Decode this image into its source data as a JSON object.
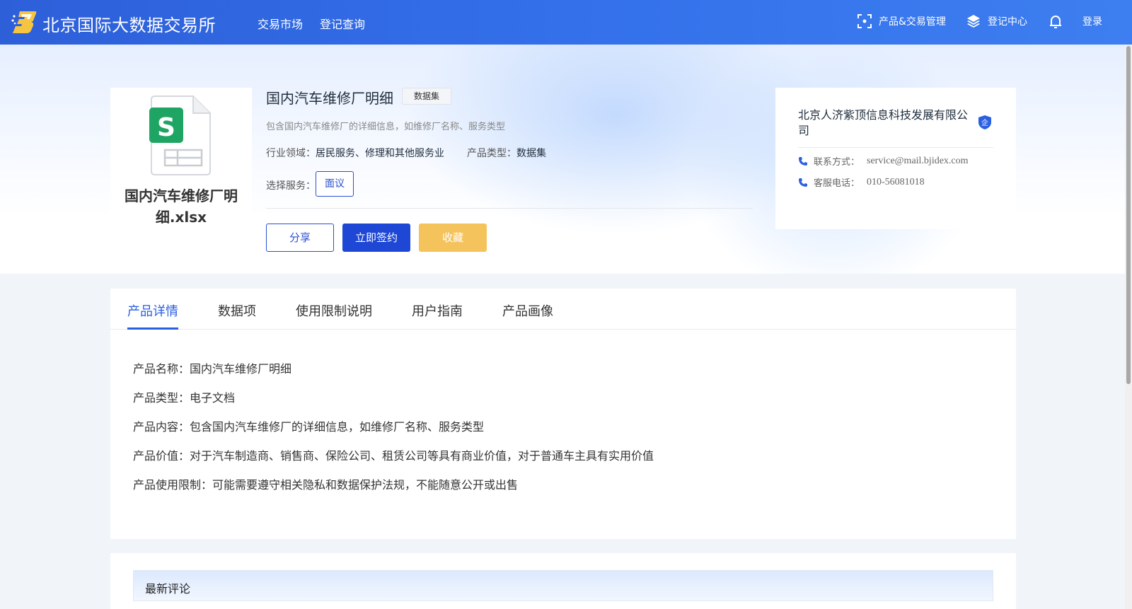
{
  "header": {
    "brand": "北京国际大数据交易所",
    "nav": [
      "交易市场",
      "登记查询"
    ],
    "product_mgmt_label": "产品&交易管理",
    "register_center_label": "登记中心",
    "login_label": "登录"
  },
  "product": {
    "file_name": "国内汽车维修厂明细.xlsx",
    "title": "国内汽车维修厂明细",
    "tag": "数据集",
    "description": "包含国内汽车维修厂的详细信息，如维修厂名称、服务类型",
    "industry_label": "行业领域：",
    "industry_value": "居民服务、修理和其他服务业",
    "type_label": "产品类型：",
    "type_value": "数据集",
    "service_label": "选择服务：",
    "service_option": "面议",
    "share_label": "分享",
    "sign_label": "立即签约",
    "favorite_label": "收藏"
  },
  "company": {
    "name": "北京人济紫顶信息科技发展有限公司",
    "badge": "企",
    "contact_label": "联系方式：",
    "contact_value": "service@mail.bjidex.com",
    "phone_label": "客服电话：",
    "phone_value": "010-56081018"
  },
  "tabs": [
    "产品详情",
    "数据项",
    "使用限制说明",
    "用户指南",
    "产品画像"
  ],
  "details": [
    "产品名称：国内汽车维修厂明细",
    "产品类型：电子文档",
    "产品内容：包含国内汽车维修厂的详细信息，如维修厂名称、服务类型",
    "产品价值：对于汽车制造商、销售商、保险公司、租赁公司等具有商业价值，对于普通车主具有实用价值",
    "产品使用限制：可能需要遵守相关隐私和数据保护法规，不能随意公开或出售"
  ],
  "comments": {
    "title": "最新评论"
  },
  "colors": {
    "header_blue": "#3370ea",
    "primary": "#1e47d6",
    "favorite": "#f4c35c",
    "tab_active": "#2a5fe0"
  }
}
